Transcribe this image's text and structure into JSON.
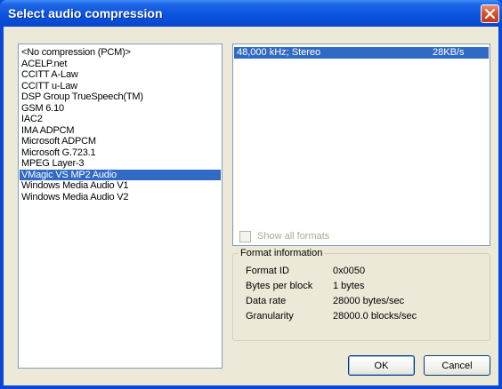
{
  "window": {
    "title": "Select audio compression"
  },
  "codecs": [
    {
      "label": "<No compression (PCM)>",
      "selected": false
    },
    {
      "label": "ACELP.net",
      "selected": false
    },
    {
      "label": "CCITT A-Law",
      "selected": false
    },
    {
      "label": "CCITT u-Law",
      "selected": false
    },
    {
      "label": "DSP Group TrueSpeech(TM)",
      "selected": false
    },
    {
      "label": "GSM 6.10",
      "selected": false
    },
    {
      "label": "IAC2",
      "selected": false
    },
    {
      "label": "IMA ADPCM",
      "selected": false
    },
    {
      "label": "Microsoft ADPCM",
      "selected": false
    },
    {
      "label": "Microsoft G.723.1",
      "selected": false
    },
    {
      "label": "MPEG Layer-3",
      "selected": false
    },
    {
      "label": "VMagic VS MP2 Audio",
      "selected": true
    },
    {
      "label": "Windows Media Audio V1",
      "selected": false
    },
    {
      "label": "Windows Media Audio V2",
      "selected": false
    }
  ],
  "formats": [
    {
      "name": "48,000 kHz; Stereo",
      "rate": "28KB/s",
      "selected": true
    }
  ],
  "show_all_formats": {
    "label": "Show all formats",
    "checked": false,
    "enabled": false
  },
  "format_info": {
    "legend": "Format information",
    "rows": [
      {
        "label": "Format ID",
        "value": "0x0050"
      },
      {
        "label": "Bytes per block",
        "value": "1 bytes"
      },
      {
        "label": "Data rate",
        "value": "28000 bytes/sec"
      },
      {
        "label": "Granularity",
        "value": "28000.0 blocks/sec"
      }
    ]
  },
  "buttons": {
    "ok": "OK",
    "cancel": "Cancel"
  },
  "icons": {
    "close": "close-icon"
  },
  "colors": {
    "title_bar": "#0a54e0",
    "close_button": "#d6532e",
    "selection": "#316ac5",
    "dialog_face": "#ece9d8"
  }
}
